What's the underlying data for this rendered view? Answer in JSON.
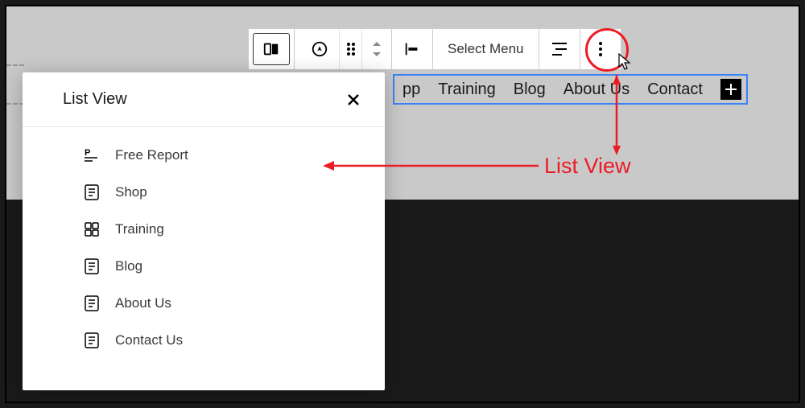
{
  "toolbar": {
    "select_menu_label": "Select Menu"
  },
  "nav": {
    "items": [
      "pp",
      "Training",
      "Blog",
      "About Us",
      "Contact"
    ],
    "add_label": "+"
  },
  "list_panel": {
    "title": "List View",
    "items": [
      {
        "icon": "letter-p",
        "label": "Free Report"
      },
      {
        "icon": "page",
        "label": "Shop"
      },
      {
        "icon": "grid",
        "label": "Training"
      },
      {
        "icon": "page",
        "label": "Blog"
      },
      {
        "icon": "page",
        "label": "About Us"
      },
      {
        "icon": "page",
        "label": "Contact Us"
      }
    ]
  },
  "annotation": {
    "label": "List View"
  }
}
